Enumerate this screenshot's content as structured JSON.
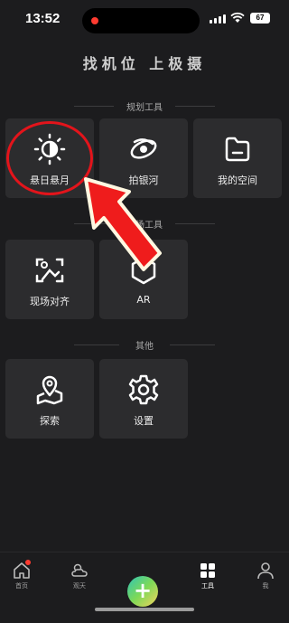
{
  "status_bar": {
    "time": "13:52",
    "battery": "67"
  },
  "title": "找机位 上极摄",
  "sections": [
    {
      "label": "规划工具",
      "items": [
        {
          "label": "悬日悬月",
          "icon": "sun-moon-icon"
        },
        {
          "label": "拍银河",
          "icon": "galaxy-icon"
        },
        {
          "label": "我的空间",
          "icon": "folder-icon"
        }
      ]
    },
    {
      "label": "现场工具",
      "items": [
        {
          "label": "现场对齐",
          "icon": "scene-align-icon"
        },
        {
          "label": "AR",
          "icon": "ar-icon"
        }
      ]
    },
    {
      "label": "其他",
      "items": [
        {
          "label": "探索",
          "icon": "map-pin-icon"
        },
        {
          "label": "设置",
          "icon": "gear-icon"
        }
      ]
    }
  ],
  "tabs": [
    {
      "label": "首页",
      "icon": "home-icon"
    },
    {
      "label": "观天",
      "icon": "weather-icon"
    },
    {
      "label": "",
      "icon": "plus-icon"
    },
    {
      "label": "工具",
      "icon": "grid-icon"
    },
    {
      "label": "我",
      "icon": "person-icon"
    }
  ],
  "annotations": {
    "highlight_color": "#e3141b"
  }
}
